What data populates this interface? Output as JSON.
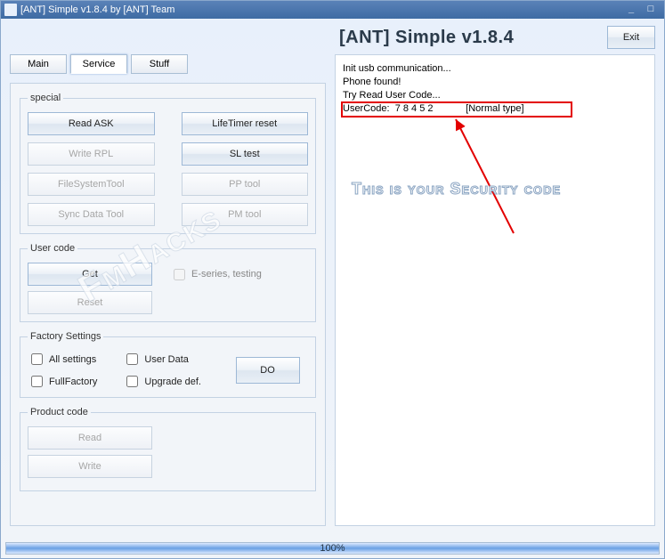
{
  "window": {
    "title": "[ANT] Simple v1.8.4 by [ANT] Team"
  },
  "header": {
    "app_title": "[ANT] Simple v1.8.4",
    "exit": "Exit"
  },
  "tabs": {
    "main": "Main",
    "service": "Service",
    "stuff": "Stuff"
  },
  "special": {
    "legend": "special",
    "read_ask": "Read ASK",
    "lifetimer": "LifeTimer reset",
    "write_rpl": "Write RPL",
    "sl_test": "SL test",
    "filesystem": "FileSystemTool",
    "pp_tool": "PP tool",
    "syncdata": "Sync Data Tool",
    "pm_tool": "PM tool"
  },
  "usercode": {
    "legend": "User code",
    "get": "Get",
    "reset": "Reset",
    "eseries": "E-series, testing"
  },
  "factory": {
    "legend": "Factory Settings",
    "allsettings": "All settings",
    "userdata": "User Data",
    "fullfactory": "FullFactory",
    "upgrade": "Upgrade def.",
    "do": "DO"
  },
  "product": {
    "legend": "Product code",
    "read": "Read",
    "write": "Write"
  },
  "log": {
    "line1": "Init usb communication...",
    "line2": "Phone found!",
    "line3": "Try Read User Code...",
    "user_line": "UserCode:  7 8 4 5 2            [Normal type]"
  },
  "annotation": "This is your Security code",
  "watermark": "FmHacks",
  "progress": "100%"
}
